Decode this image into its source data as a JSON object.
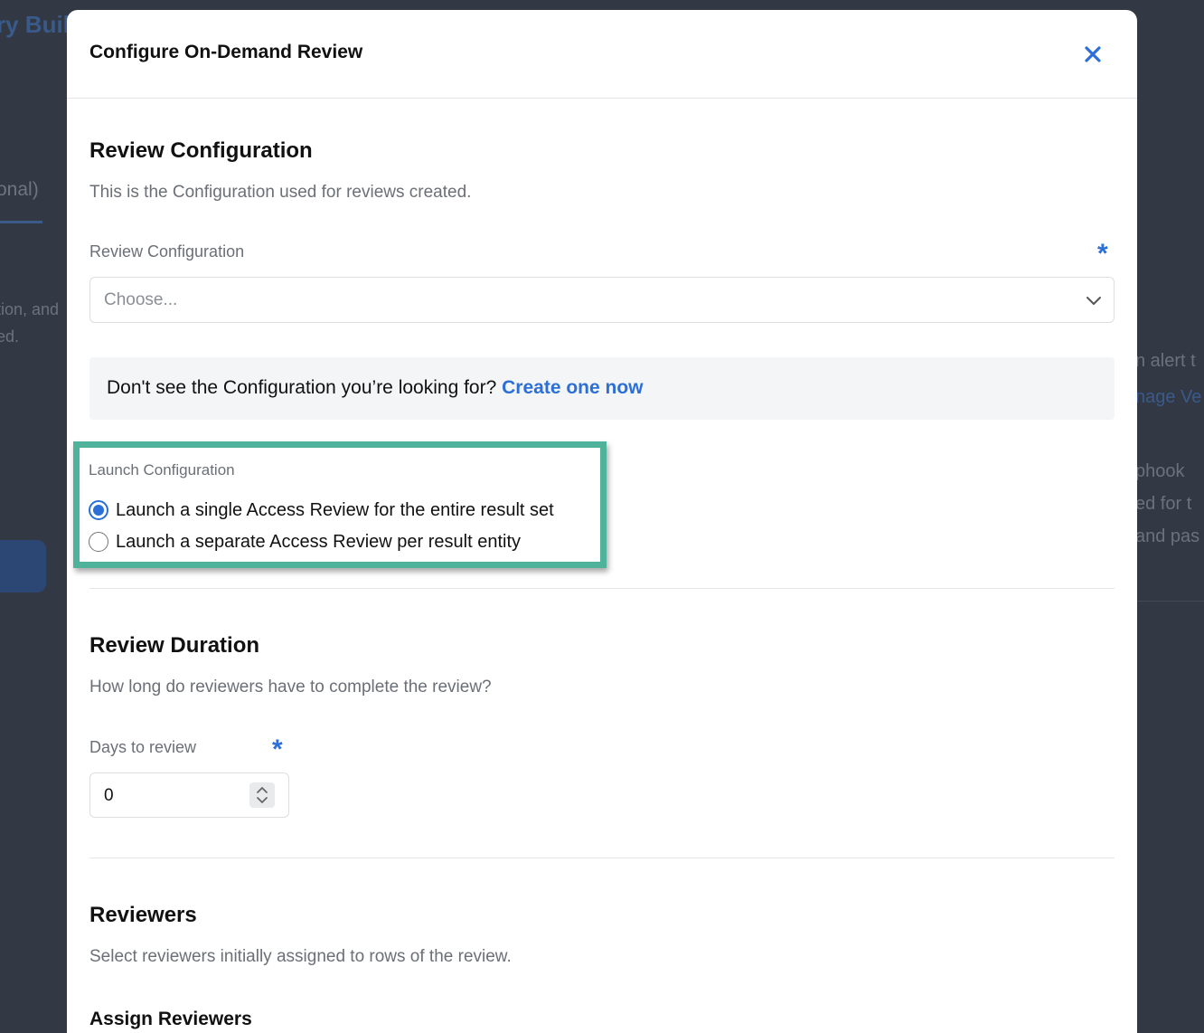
{
  "background": {
    "left_title": "ry Build",
    "left_tab": "onal)",
    "left_text_1": "tion, and",
    "left_text_2": "ed.",
    "right_text_1": "n alert t",
    "right_link": "nage Ve",
    "right_text_2": "phook",
    "right_text_3": "ed for t",
    "right_text_4": "and pas"
  },
  "modal": {
    "title": "Configure On-Demand Review"
  },
  "review_configuration": {
    "title": "Review Configuration",
    "description": "This is the Configuration used for reviews created.",
    "field_label": "Review Configuration",
    "required_mark": "*",
    "placeholder": "Choose...",
    "info_text": "Don't see the Configuration you’re looking for?",
    "info_link": "Create one now"
  },
  "launch_configuration": {
    "label": "Launch Configuration",
    "options": [
      {
        "label": "Launch a single Access Review for the entire result set",
        "checked": true
      },
      {
        "label": "Launch a separate Access Review per result entity",
        "checked": false
      }
    ]
  },
  "review_duration": {
    "title": "Review Duration",
    "description": "How long do reviewers have to complete the review?",
    "field_label": "Days to review",
    "required_mark": "*",
    "value": "0"
  },
  "reviewers": {
    "title": "Reviewers",
    "description": "Select reviewers initially assigned to rows of the review.",
    "assign_title": "Assign Reviewers"
  },
  "colors": {
    "accent": "#2c6fd6",
    "highlight_border": "#4fb39c",
    "overlay": "#2f3542"
  }
}
